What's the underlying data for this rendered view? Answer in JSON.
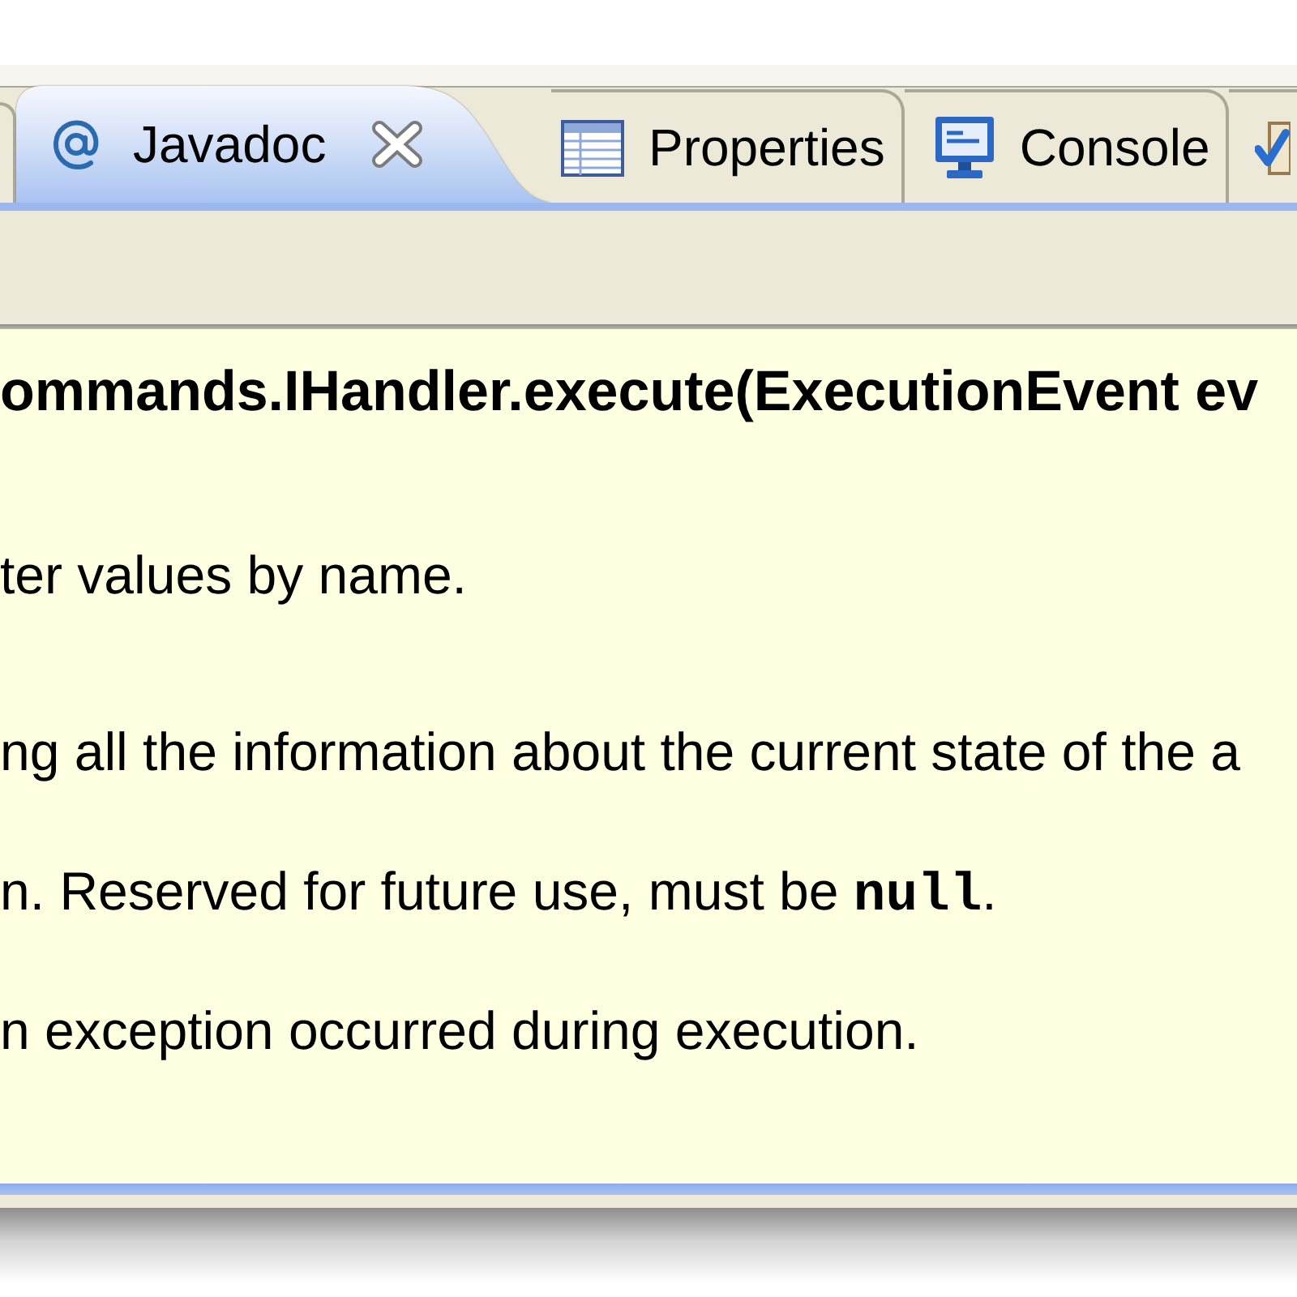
{
  "tabs": [
    {
      "selected": false
    },
    {
      "label": "Javadoc",
      "selected": true
    },
    {
      "label": "Properties",
      "selected": false
    },
    {
      "label": "Console",
      "selected": false
    },
    {
      "selected": false
    }
  ],
  "javadoc": {
    "signature": "ommands.IHandler.execute(ExecutionEvent ev",
    "description": "ter values by name.",
    "parameters": [
      {
        "segments": [
          {
            "kind": "text",
            "text": "ng all the information about the current state of the a"
          }
        ]
      },
      {
        "segments": [
          {
            "kind": "text",
            "text": "n. Reserved for future use, must be "
          },
          {
            "kind": "code",
            "text": "null"
          },
          {
            "kind": "text",
            "text": "."
          }
        ]
      }
    ],
    "throws": [
      {
        "segments": [
          {
            "kind": "text",
            "text": "n exception occurred during execution."
          }
        ]
      }
    ]
  }
}
